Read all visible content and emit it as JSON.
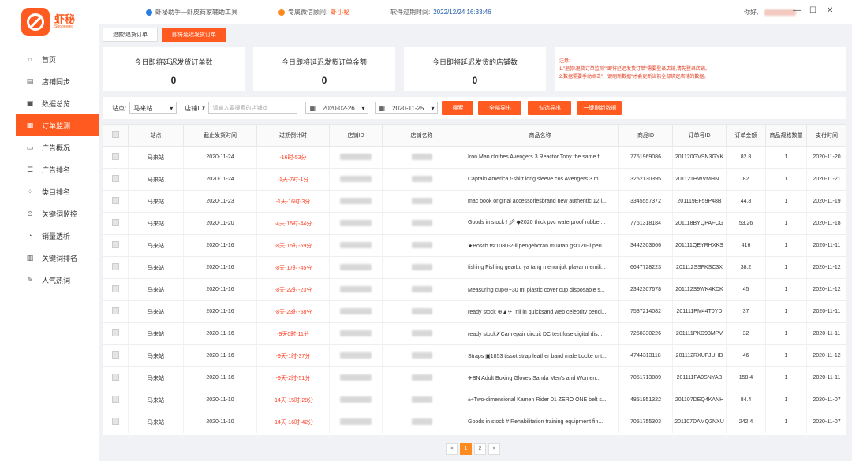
{
  "titlebar": {
    "app_tool": "虾秘助手—虾皮商家辅助工具",
    "wechat_label": "专属微信顾问:",
    "wechat_name": "虾小秘",
    "expire_label": "软件过期时间:",
    "expire_time": "2022/12/24 16:33:46",
    "greeting": "你好,",
    "minimize": "—",
    "maximize": "☐",
    "close": "✕"
  },
  "brand": {
    "name": "虾秘",
    "sub": "Shopeemo",
    "color": "#ff5a1f"
  },
  "sidebar": {
    "items": [
      {
        "label": "首页",
        "icon": "home-icon",
        "glyph": "⌂"
      },
      {
        "label": "店铺同步",
        "icon": "store-icon",
        "glyph": "▤"
      },
      {
        "label": "数据总览",
        "icon": "monitor-icon",
        "glyph": "▣"
      },
      {
        "label": "订单监测",
        "icon": "order-icon",
        "glyph": "▦",
        "active": true
      },
      {
        "label": "广告概况",
        "icon": "ad-icon",
        "glyph": "▭"
      },
      {
        "label": "广告排名",
        "icon": "list-icon",
        "glyph": "☰"
      },
      {
        "label": "类目排名",
        "icon": "category-icon",
        "glyph": "⁘"
      },
      {
        "label": "关键词监控",
        "icon": "target-icon",
        "glyph": "⊙"
      },
      {
        "label": "销量透析",
        "icon": "pie-icon",
        "glyph": "◔"
      },
      {
        "label": "关键词排名",
        "icon": "rank-icon",
        "glyph": "▥"
      },
      {
        "label": "人气热词",
        "icon": "hot-icon",
        "glyph": "✎"
      }
    ]
  },
  "tabs": [
    {
      "label": "退款\\退货订单",
      "active": false
    },
    {
      "label": "即将延迟发货订单",
      "active": true
    }
  ],
  "stats": [
    {
      "label": "今日即将延迟发货订单数",
      "value": "0"
    },
    {
      "label": "今日即将延迟发货订单金额",
      "value": "0"
    },
    {
      "label": "今日即将延迟发货的店铺数",
      "value": "0"
    }
  ],
  "notice": {
    "title": "注意:",
    "line1": "1.\"退款\\退货订单监测\"\"即将延迟发货订单\"需要登录店铺,请先登录店铺。",
    "line2": "2.数据需要手动点击\"一键刷新数据\"才会更新当前全部绑定店铺的数据。"
  },
  "filters": {
    "site_label": "站点:",
    "site_value": "马来站",
    "shop_label": "店铺ID:",
    "shop_placeholder": "请输入要搜索的店铺id",
    "date_start": "2020-02-26",
    "date_end": "2020-11-25",
    "search": "搜索",
    "export_all": "全部导出",
    "export_checked": "勾选导出",
    "refresh": "一键刷新数据"
  },
  "table": {
    "headers": [
      "站点",
      "截止发货时间",
      "过期倒计时",
      "店铺ID",
      "店铺名称",
      "商品名称",
      "商品ID",
      "订单号ID",
      "订单金额",
      "商品规格数量",
      "支付时间"
    ],
    "rows": [
      [
        "马来站",
        "2020-11-24",
        "-16时-53分",
        "",
        "",
        "Iron Man clothes Avengers 3 Reactor Tony the same f...",
        "7751969086",
        "201120GVSN3GYK",
        "82.8",
        "1",
        "2020-11-20"
      ],
      [
        "马来站",
        "2020-11-24",
        "-1天-7时-1分",
        "",
        "",
        "Captain America t-shirt long sleeve cos Avengers 3 m...",
        "3252130395",
        "201121HWVMHN...",
        "82",
        "1",
        "2020-11-21"
      ],
      [
        "马来站",
        "2020-11-23",
        "-1天-16时-3分",
        "",
        "",
        "mac book original accessoriesbrand new authentic 12 i...",
        "3345557372",
        "201119EF59P48B",
        "44.8",
        "1",
        "2020-11-19"
      ],
      [
        "马来站",
        "2020-11-20",
        "-4天-15时-44分",
        "",
        "",
        "Goods in stock ! 🖉 ◆2020 thick pvc waterproof rubber...",
        "7751318184",
        "201118BYQPAFCG",
        "53.26",
        "1",
        "2020-11-18"
      ],
      [
        "马来站",
        "2020-11-16",
        "-8天-15时-59分",
        "",
        "",
        "★Bosch tsr1080-2-li pengeboran muatan gsr120-li pen...",
        "3442303666",
        "201111QEYRHXKS",
        "416",
        "1",
        "2020-11-11"
      ],
      [
        "马来站",
        "2020-11-16",
        "-8天-17时-45分",
        "",
        "",
        "fishing Fishing gearLu ya tang menunjuk playar memili...",
        "6647728223",
        "201112SSFKSC3X",
        "38.2",
        "1",
        "2020-11-12"
      ],
      [
        "马来站",
        "2020-11-16",
        "-8天-22时-23分",
        "",
        "",
        "Measuring cup⊕+30 ml plastic cover cup disposable s...",
        "2342307678",
        "201112S9WK4KDK",
        "45",
        "1",
        "2020-11-12"
      ],
      [
        "马来站",
        "2020-11-16",
        "-8天-23时-58分",
        "",
        "",
        "ready stock ⊕▲✈Trill in quicksand web celebrity penci...",
        "7537214082",
        "201111PM44T0YD",
        "37",
        "1",
        "2020-11-11"
      ],
      [
        "马来站",
        "2020-11-16",
        "-9天0时-11分",
        "",
        "",
        "ready stock✗Car repair circuit DC test fuse digital dis...",
        "7258330226",
        "201111PKD93MPV",
        "32",
        "1",
        "2020-11-11"
      ],
      [
        "马来站",
        "2020-11-16",
        "-9天-1时-37分",
        "",
        "",
        "Straps ▣1853 tissot strap leather band male Locke crit...",
        "4744313118",
        "201112RXUFJUHB",
        "46",
        "1",
        "2020-11-12"
      ],
      [
        "马来站",
        "2020-11-16",
        "-9天-2时-51分",
        "",
        "",
        "✈BN Adult Boxing Gloves Sanda Men's and Women...",
        "7051713889",
        "201111PA9SNYAB",
        "158.4",
        "1",
        "2020-11-11"
      ],
      [
        "马来站",
        "2020-11-10",
        "-14天-15时-28分",
        "",
        "",
        "±÷Two-dimensional Kamen Rider 01 ZERO ONE belt s...",
        "4851951322",
        "201107DEQ4KANH",
        "84.4",
        "1",
        "2020-11-07"
      ],
      [
        "马来站",
        "2020-11-10",
        "-14天-16时-42分",
        "",
        "",
        "Goods in stock # Rehabilitation training equipment fin...",
        "7051755303",
        "201107DAMQ2NXU",
        "242.4",
        "1",
        "2020-11-07"
      ]
    ]
  },
  "pagination": {
    "prev": "<",
    "pages": [
      "1",
      "2"
    ],
    "current": "1",
    "next": ">"
  }
}
